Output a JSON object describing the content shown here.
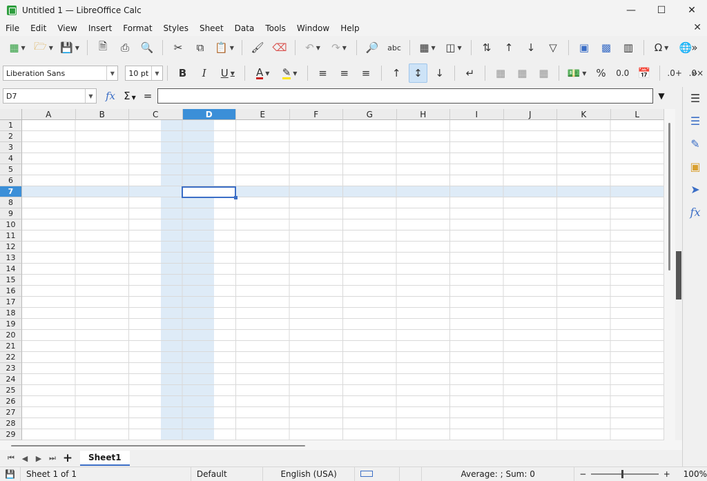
{
  "window": {
    "title": "Untitled 1 — LibreOffice Calc",
    "min_icon": "minimize-icon",
    "max_icon": "maximize-icon",
    "close_icon": "close-icon"
  },
  "menu": {
    "items": [
      "File",
      "Edit",
      "View",
      "Insert",
      "Format",
      "Styles",
      "Sheet",
      "Data",
      "Tools",
      "Window",
      "Help"
    ]
  },
  "format": {
    "font_name": "Liberation Sans",
    "font_size": "10 pt"
  },
  "formula": {
    "cell_ref": "D7",
    "content": ""
  },
  "grid": {
    "columns": [
      "A",
      "B",
      "C",
      "D",
      "E",
      "F",
      "G",
      "H",
      "I",
      "J",
      "K",
      "L"
    ],
    "rows": [
      "1",
      "2",
      "3",
      "4",
      "5",
      "6",
      "7",
      "8",
      "9",
      "10",
      "11",
      "12",
      "13",
      "14",
      "15",
      "16",
      "17",
      "18",
      "19",
      "20",
      "21",
      "22",
      "23",
      "24",
      "25",
      "26",
      "27",
      "28",
      "29"
    ],
    "selected_column": "D",
    "selected_row": "7"
  },
  "sheets": {
    "tabs": [
      "Sheet1"
    ],
    "active": "Sheet1"
  },
  "status": {
    "sheet_info": "Sheet 1 of 1",
    "page_style": "Default",
    "language": "English (USA)",
    "summary": "Average: ; Sum: 0",
    "zoom": "100%"
  },
  "colors": {
    "selection": "#3b8fd8",
    "highlight": "#deebf7",
    "cursor": "#3b6ec6",
    "app_icon": "#2e9e3e"
  }
}
